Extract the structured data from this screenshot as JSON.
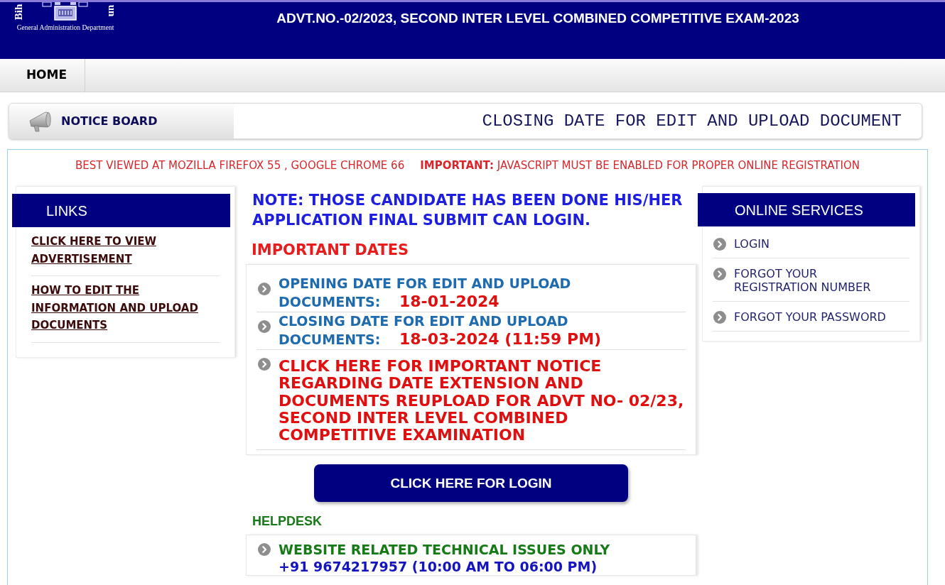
{
  "header": {
    "logo_marks": [
      "Bih",
      "un"
    ],
    "logo_caption": "General Administration Department",
    "title": "ADVT.NO.-02/2023, SECOND INTER LEVEL COMBINED COMPETITIVE EXAM-2023"
  },
  "nav": {
    "items": [
      "HOME"
    ]
  },
  "notice_board": {
    "label": "NOTICE BOARD",
    "ticker": "CLOSING DATE FOR EDIT AND UPLOAD DOCUMENT"
  },
  "banner": {
    "browser_note": "BEST VIEWED AT MOZILLA FIREFOX 55 , GOOGLE CHROME 66",
    "javascript_note": "**IMPORTANT:** JAVASCRIPT MUST BE ENABLED FOR PROPER ONLINE REGISTRATION"
  },
  "links": {
    "title": "LINKS",
    "items": [
      "CLICK HERE TO VIEW ADVERTISEMENT",
      "HOW TO EDIT THE INFORMATION AND UPLOAD DOCUMENTS"
    ]
  },
  "note": "NOTE: THOSE CANDIDATE HAS BEEN DONE HIS/HER APPLICATION FINAL SUBMIT CAN LOGIN.",
  "important_dates": {
    "title": "IMPORTANT DATES",
    "items": [
      {
        "kind": "date",
        "text": "OPENING DATE FOR EDIT AND UPLOAD DOCUMENTS: **18-01-2024**"
      },
      {
        "kind": "date",
        "text": "CLOSING DATE FOR EDIT AND UPLOAD DOCUMENTS: **18-03-2024 (11:59 PM)**"
      },
      {
        "kind": "notice",
        "text": "CLICK HERE FOR IMPORTANT NOTICE REGARDING DATE EXTENSION AND DOCUMENTS REUPLOAD FOR ADVT NO- 02/23, SECOND INTER LEVEL COMBINED COMPETITIVE EXAMINATION"
      }
    ]
  },
  "login_button": "CLICK HERE FOR LOGIN",
  "helpdesk": {
    "title": "HELPDESK",
    "items": [
      {
        "label": "WEBSITE RELATED TECHNICAL ISSUES ONLY",
        "phone": "+91 9674217957 (10:00 AM TO 06:00 PM)"
      }
    ]
  },
  "online_services": {
    "title": "ONLINE SERVICES",
    "items": [
      "LOGIN",
      "FORGOT YOUR REGISTRATION NUMBER",
      "FORGOT YOUR PASSWORD"
    ]
  }
}
